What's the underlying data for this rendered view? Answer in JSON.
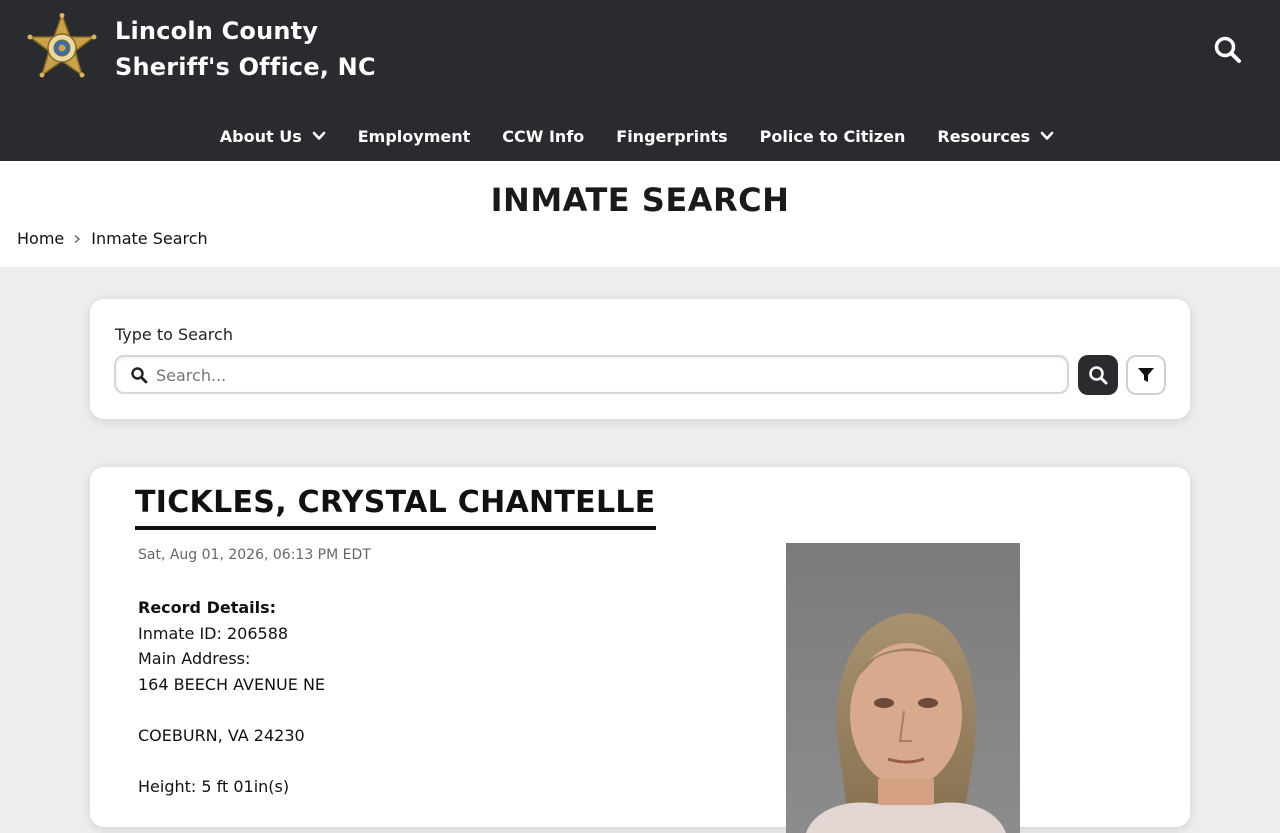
{
  "header": {
    "site_name_line1": "Lincoln County",
    "site_name_line2": "Sheriff's Office, NC",
    "badge_icon": "sheriff-star-badge-icon",
    "search_icon": "search-icon"
  },
  "nav": {
    "items": [
      {
        "label": "About Us",
        "has_dropdown": true
      },
      {
        "label": "Employment",
        "has_dropdown": false
      },
      {
        "label": "CCW Info",
        "has_dropdown": false
      },
      {
        "label": "Fingerprints",
        "has_dropdown": false
      },
      {
        "label": "Police to Citizen",
        "has_dropdown": false
      },
      {
        "label": "Resources",
        "has_dropdown": true
      }
    ]
  },
  "page": {
    "title": "INMATE SEARCH",
    "breadcrumb": [
      {
        "label": "Home"
      },
      {
        "label": "Inmate Search"
      }
    ]
  },
  "search": {
    "label": "Type to Search",
    "placeholder": "Search...",
    "value": ""
  },
  "inmate": {
    "name": "TICKLES, CRYSTAL CHANTELLE",
    "timestamp": "Sat, Aug 01, 2026, 06:13 PM EDT",
    "record_details_label": "Record Details:",
    "inmate_id": "Inmate ID: 206588",
    "main_address_label": "Main Address:",
    "address_line1": "164 BEECH AVENUE NE",
    "address_line2": "COEBURN, VA 24230",
    "height": "Height: 5 ft 01in(s)"
  },
  "colors": {
    "header_bg": "#2a2b2e",
    "page_bg": "#ededed",
    "badge_gold": "#c9a24a"
  }
}
